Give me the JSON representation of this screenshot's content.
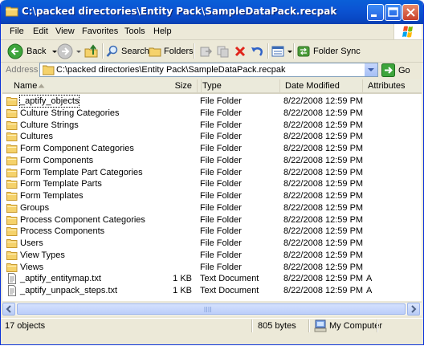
{
  "window": {
    "title": "C:\\packed directories\\Entity Pack\\SampleDataPack.recpak"
  },
  "menu": [
    "File",
    "Edit",
    "View",
    "Favorites",
    "Tools",
    "Help"
  ],
  "toolbar": {
    "back_label": "Back",
    "search_label": "Search",
    "folders_label": "Folders",
    "folder_sync_label": "Folder Sync"
  },
  "address": {
    "label": "Address",
    "value": "C:\\packed directories\\Entity Pack\\SampleDataPack.recpak",
    "go_label": "Go"
  },
  "columns": {
    "name": "Name",
    "size": "Size",
    "type": "Type",
    "date": "Date Modified",
    "attributes": "Attributes"
  },
  "files": [
    {
      "name": "_aptify_objects",
      "size": "",
      "type": "File Folder",
      "date": "8/22/2008 12:59 PM",
      "attr": "",
      "icon": "folder-icon"
    },
    {
      "name": "Culture String Categories",
      "size": "",
      "type": "File Folder",
      "date": "8/22/2008 12:59 PM",
      "attr": "",
      "icon": "folder-icon"
    },
    {
      "name": "Culture Strings",
      "size": "",
      "type": "File Folder",
      "date": "8/22/2008 12:59 PM",
      "attr": "",
      "icon": "folder-icon"
    },
    {
      "name": "Cultures",
      "size": "",
      "type": "File Folder",
      "date": "8/22/2008 12:59 PM",
      "attr": "",
      "icon": "folder-icon"
    },
    {
      "name": "Form Component Categories",
      "size": "",
      "type": "File Folder",
      "date": "8/22/2008 12:59 PM",
      "attr": "",
      "icon": "folder-icon"
    },
    {
      "name": "Form Components",
      "size": "",
      "type": "File Folder",
      "date": "8/22/2008 12:59 PM",
      "attr": "",
      "icon": "folder-icon"
    },
    {
      "name": "Form Template Part Categories",
      "size": "",
      "type": "File Folder",
      "date": "8/22/2008 12:59 PM",
      "attr": "",
      "icon": "folder-icon"
    },
    {
      "name": "Form Template Parts",
      "size": "",
      "type": "File Folder",
      "date": "8/22/2008 12:59 PM",
      "attr": "",
      "icon": "folder-icon"
    },
    {
      "name": "Form Templates",
      "size": "",
      "type": "File Folder",
      "date": "8/22/2008 12:59 PM",
      "attr": "",
      "icon": "folder-icon"
    },
    {
      "name": "Groups",
      "size": "",
      "type": "File Folder",
      "date": "8/22/2008 12:59 PM",
      "attr": "",
      "icon": "folder-icon"
    },
    {
      "name": "Process Component Categories",
      "size": "",
      "type": "File Folder",
      "date": "8/22/2008 12:59 PM",
      "attr": "",
      "icon": "folder-icon"
    },
    {
      "name": "Process Components",
      "size": "",
      "type": "File Folder",
      "date": "8/22/2008 12:59 PM",
      "attr": "",
      "icon": "folder-icon"
    },
    {
      "name": "Users",
      "size": "",
      "type": "File Folder",
      "date": "8/22/2008 12:59 PM",
      "attr": "",
      "icon": "folder-icon"
    },
    {
      "name": "View Types",
      "size": "",
      "type": "File Folder",
      "date": "8/22/2008 12:59 PM",
      "attr": "",
      "icon": "folder-icon"
    },
    {
      "name": "Views",
      "size": "",
      "type": "File Folder",
      "date": "8/22/2008 12:59 PM",
      "attr": "",
      "icon": "folder-icon"
    },
    {
      "name": "_aptify_entitymap.txt",
      "size": "1 KB",
      "type": "Text Document",
      "date": "8/22/2008 12:59 PM",
      "attr": "A",
      "icon": "text-document-icon"
    },
    {
      "name": "_aptify_unpack_steps.txt",
      "size": "1 KB",
      "type": "Text Document",
      "date": "8/22/2008 12:59 PM",
      "attr": "A",
      "icon": "text-document-icon"
    }
  ],
  "status": {
    "count": "17 objects",
    "size": "805 bytes",
    "zone": "My Computer"
  },
  "colors": {
    "titlebar": "#0a5fd8",
    "chrome": "#ece9d8",
    "folder": "#f5d26b"
  }
}
